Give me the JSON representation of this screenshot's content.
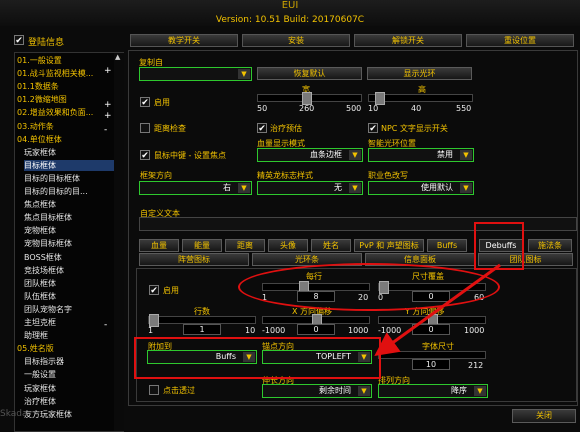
{
  "window": {
    "title": "EUI",
    "version": "Version: 10.51 Build: 20170607C"
  },
  "login_checkbox": {
    "label": "登陆信息",
    "checked": true
  },
  "top_tabs": [
    "教学开关",
    "安装",
    "解锁开关",
    "重设位置"
  ],
  "sidebar": {
    "items": [
      {
        "label": "01.一般设置",
        "sub": false,
        "sel": false
      },
      {
        "label": "01.战斗监视相关模...",
        "sub": false,
        "sel": false
      },
      {
        "label": "01.1数据条",
        "sub": false,
        "sel": false
      },
      {
        "label": "01.2微缩地图",
        "sub": false,
        "sel": false
      },
      {
        "label": "02.增益效果和负面...",
        "sub": false,
        "sel": false
      },
      {
        "label": "03.动作条",
        "sub": false,
        "sel": false
      },
      {
        "label": "04.单位框体",
        "sub": false,
        "sel": false
      },
      {
        "label": "玩家框体",
        "sub": true,
        "sel": false
      },
      {
        "label": "目标框体",
        "sub": true,
        "sel": true
      },
      {
        "label": "目标的目标框体",
        "sub": true,
        "sel": false
      },
      {
        "label": "目标的目标的目...",
        "sub": true,
        "sel": false
      },
      {
        "label": "焦点框体",
        "sub": true,
        "sel": false
      },
      {
        "label": "焦点目标框体",
        "sub": true,
        "sel": false
      },
      {
        "label": "宠物框体",
        "sub": true,
        "sel": false
      },
      {
        "label": "宠物目标框体",
        "sub": true,
        "sel": false
      },
      {
        "label": "BOSS框体",
        "sub": true,
        "sel": false
      },
      {
        "label": "竞技场框体",
        "sub": true,
        "sel": false
      },
      {
        "label": "团队框体",
        "sub": true,
        "sel": false
      },
      {
        "label": "队伍框体",
        "sub": true,
        "sel": false
      },
      {
        "label": "团队宠物名字",
        "sub": true,
        "sel": false
      },
      {
        "label": "主坦克框",
        "sub": true,
        "sel": false
      },
      {
        "label": "助理框",
        "sub": true,
        "sel": false
      },
      {
        "label": "05.姓名版",
        "sub": false,
        "sel": false
      },
      {
        "label": "目标指示器",
        "sub": true,
        "sel": false
      },
      {
        "label": "一般设置",
        "sub": true,
        "sel": false
      },
      {
        "label": "玩家框体",
        "sub": true,
        "sel": false
      },
      {
        "label": "治疗框体",
        "sub": true,
        "sel": false
      },
      {
        "label": "友方玩家框体",
        "sub": true,
        "sel": false
      }
    ],
    "expanders": [
      "+",
      "+",
      "+",
      "-",
      "-"
    ]
  },
  "copy_from": {
    "label": "复制自",
    "value": ""
  },
  "restore_default": "恢复默认",
  "show_halo": "显示光环",
  "enable": {
    "label": "启用",
    "checked": true
  },
  "width": {
    "label": "宽",
    "min": "50",
    "value": "260",
    "max": "500",
    "fraction": 0.46
  },
  "height": {
    "label": "高",
    "min": "10",
    "value": "40",
    "max": "550",
    "fraction": 0.06
  },
  "range_check": {
    "label": "距离检查",
    "checked": false
  },
  "heal_prediction": {
    "label": "治疗预估",
    "checked": true
  },
  "npc_text": {
    "label": "NPC 文字显示开关",
    "checked": true
  },
  "mouse_focus": {
    "label": "鼠标中键 - 设置焦点",
    "checked": true
  },
  "health_mode": {
    "label": "血量显示模式",
    "value": "血条边框"
  },
  "smart_halo": {
    "label": "智能光环位置",
    "value": "禁用"
  },
  "frame_dir": {
    "label": "框架方向",
    "value": "右"
  },
  "elite_style": {
    "label": "精英龙标志样式",
    "value": "无"
  },
  "class_color": {
    "label": "职业色改写",
    "value": "使用默认"
  },
  "custom_text": {
    "label": "自定义文本",
    "value": ""
  },
  "sub_tabs_row1": [
    "血量",
    "能量",
    "距离",
    "头像",
    "姓名",
    "PvP 和 声望图标",
    "Buffs",
    "Debuffs",
    "施法条"
  ],
  "sub_tabs_row2": [
    "阵营图标",
    "光环条",
    "信息面板",
    "团队图标"
  ],
  "inner_enable": {
    "label": "启用",
    "checked": true
  },
  "per_row": {
    "label": "每行",
    "min": "1",
    "value": "8",
    "max": "20",
    "fraction": 0.37
  },
  "size_override": {
    "label": "尺寸覆盖",
    "min": "0",
    "value": "0",
    "max": "60",
    "fraction": 0.0
  },
  "rows": {
    "label": "行数",
    "min": "1",
    "value": "1",
    "max": "10",
    "fraction": 0.0
  },
  "x_offset": {
    "label": "X 方向偏移",
    "min": "-1000",
    "value": "0",
    "max": "1000",
    "fraction": 0.5
  },
  "y_offset": {
    "label": "Y 方向偏移",
    "min": "-1000",
    "value": "0",
    "max": "1000",
    "fraction": 0.5
  },
  "attach_to": {
    "label": "附加到",
    "value": "Buffs"
  },
  "anchor_point": {
    "label": "锚点方向",
    "value": "TOPLEFT"
  },
  "font_size": {
    "label": "字体尺寸",
    "value": "10",
    "max": "212"
  },
  "click_through": {
    "label": "点击透过",
    "checked": false
  },
  "grow_dir": {
    "label": "伸长方向",
    "value": "剩余时间"
  },
  "sort_dir": {
    "label": "排列方向",
    "value": "降序"
  },
  "close_button": "关闭",
  "watermark": "Skada"
}
